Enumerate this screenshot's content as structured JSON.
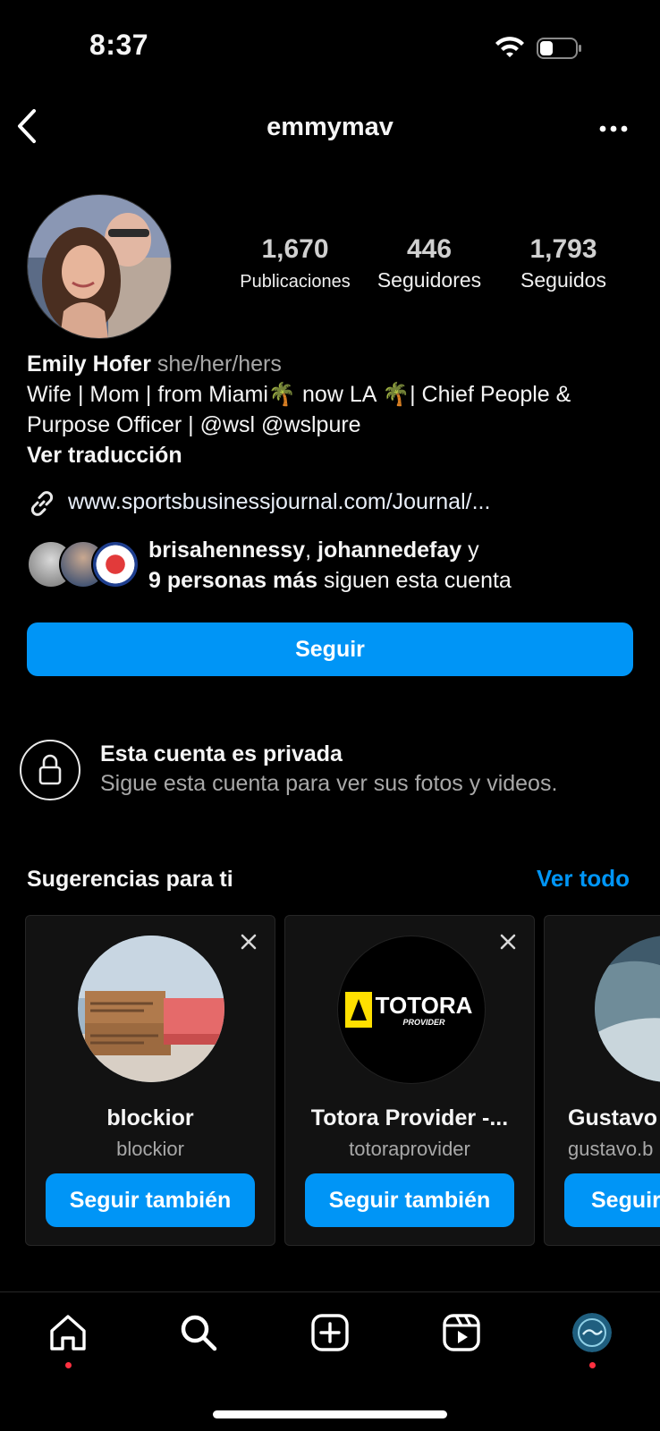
{
  "status": {
    "time": "8:37"
  },
  "header": {
    "username": "emmymav"
  },
  "profile": {
    "stats": [
      {
        "value": "1,670",
        "label": "Publicaciones"
      },
      {
        "value": "446",
        "label": "Seguidores"
      },
      {
        "value": "1,793",
        "label": "Seguidos"
      }
    ],
    "name": "Emily Hofer",
    "pronouns": "she/her/hers",
    "bio_line1": "Wife | Mom | from Miami🌴 now LA 🌴| Chief People &",
    "bio_line2": "Purpose Officer | @wsl @wslpure",
    "translate": "Ver traducción",
    "link": "www.sportsbusinessjournal.com/Journal/...",
    "mutual": {
      "user1": "brisahennessy",
      "sep": ", ",
      "user2": "johannedefay",
      "and": " y",
      "more": "9 personas más",
      "suffix": " siguen esta cuenta"
    },
    "follow_label": "Seguir"
  },
  "private": {
    "title": "Esta cuenta es privada",
    "subtitle": "Sigue esta cuenta para ver sus fotos y videos."
  },
  "suggestions": {
    "title": "Sugerencias para ti",
    "see_all": "Ver todo",
    "cards": [
      {
        "name": "blockior",
        "handle": "blockior",
        "button": "Seguir también"
      },
      {
        "name": "Totora Provider -...",
        "handle": "totoraprovider",
        "button": "Seguir también",
        "logo_top": "TOTORA",
        "logo_bottom": "PROVIDER"
      },
      {
        "name": "Gustavo",
        "handle": "gustavo.b",
        "button": "Seguir"
      }
    ]
  },
  "tabbar": {
    "icons": [
      "home-icon",
      "search-icon",
      "create-icon",
      "reels-icon",
      "profile-avatar"
    ],
    "notification_color": "#ff3040"
  },
  "colors": {
    "accent": "#0095f6",
    "background": "#000000",
    "card": "#121212"
  }
}
